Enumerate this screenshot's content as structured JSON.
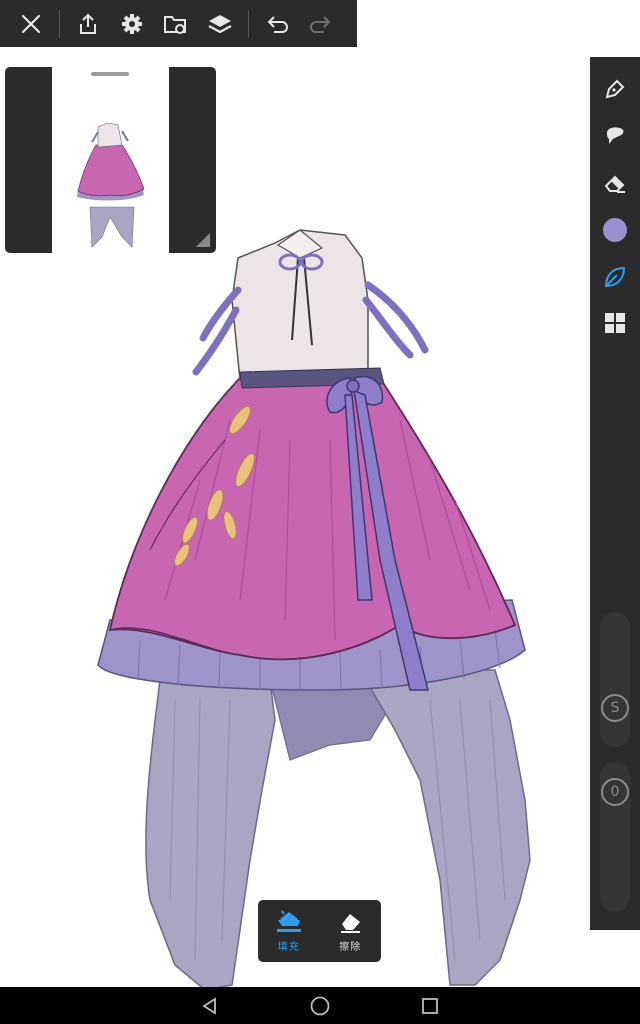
{
  "toolbar": {
    "buttons": [
      "close",
      "export",
      "settings",
      "gallery",
      "layers",
      "undo",
      "redo"
    ]
  },
  "right_rail": {
    "tools": [
      "pen-tool",
      "smudge-tool",
      "eraser-tool",
      "color-picker",
      "brush-library",
      "grid-menu"
    ],
    "current_color": "#9b8fd0",
    "size_slider_label": "S",
    "opacity_slider_label": "0"
  },
  "fill_popup": {
    "fill_label": "填充",
    "erase_label": "擦除",
    "fill_color": "#2f9cf0",
    "erase_color": "#dcdcdc"
  },
  "colors": {
    "panel_bg": "#2b2b2b",
    "icon": "#e6e6e6",
    "icon_disabled": "#707070",
    "accent_blue": "#2f9cf0",
    "skirt_pink": "#c866b2",
    "underskirt_lavender": "#9e94c9",
    "drape_gray": "#a9a6c4",
    "ribbon_purple": "#7f6fc0",
    "bodice": "#ece4e6",
    "leaf_gold": "#e8c27a"
  },
  "nav": [
    "back",
    "home",
    "recents"
  ]
}
